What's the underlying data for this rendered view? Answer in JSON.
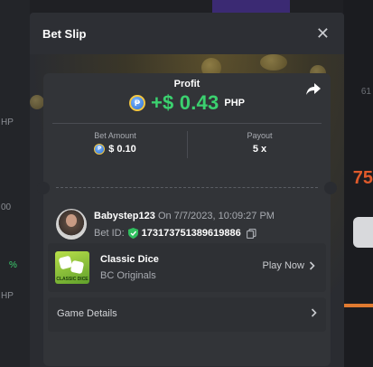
{
  "background": {
    "left_fragments": [
      "HP",
      "00",
      "%",
      "HP"
    ],
    "right_fragments": [
      "61",
      "75"
    ]
  },
  "modal": {
    "title": "Bet Slip",
    "close_icon": "close-icon"
  },
  "profit": {
    "label": "Profit",
    "amount": "+$ 0.43",
    "currency": "PHP",
    "coin_symbol": "₱",
    "share_icon": "share-arrow-icon",
    "color": "#3bd16f"
  },
  "stats": {
    "bet_amount_label": "Bet Amount",
    "bet_amount_value": "$ 0.10",
    "payout_label": "Payout",
    "payout_value": "5 x"
  },
  "bet": {
    "username": "Babystep123",
    "date": "On 7/7/2023, 10:09:27 PM",
    "bet_id_label": "Bet ID:",
    "bet_id": "173173751389619886"
  },
  "game": {
    "name": "Classic Dice",
    "provider": "BC Originals",
    "thumb_text": "CLASSIC DICE",
    "play_label": "Play Now"
  },
  "details": {
    "label": "Game Details"
  }
}
